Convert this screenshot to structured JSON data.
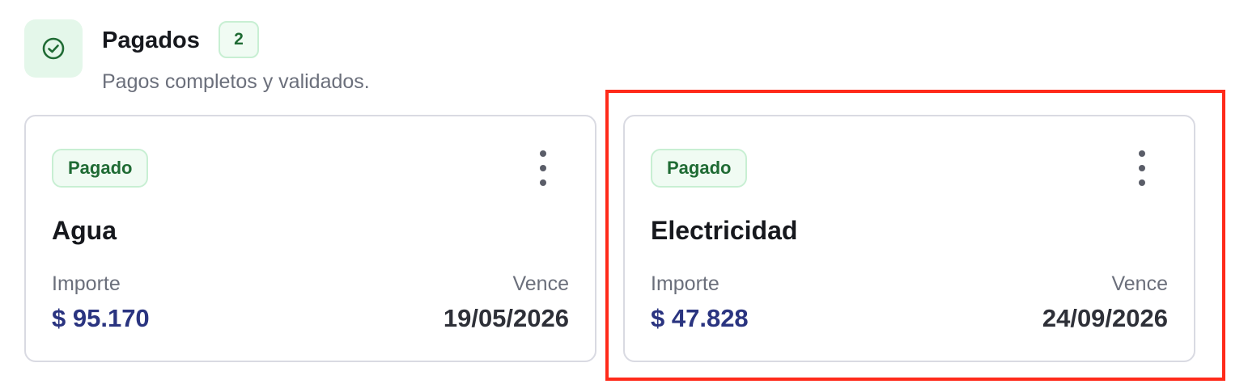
{
  "section": {
    "icon": "check-circle-icon",
    "title": "Pagados",
    "count": "2",
    "subtitle": "Pagos completos y validados."
  },
  "colors": {
    "accent_green": "#1f6b34",
    "icon_bg": "#e4f7ea",
    "amount_blue": "#2a3480",
    "highlight_red": "#ff2a1a"
  },
  "cards": [
    {
      "status": "Pagado",
      "title": "Agua",
      "amount_label": "Importe",
      "amount": "$ 95.170",
      "due_label": "Vence",
      "due_date": "19/05/2026"
    },
    {
      "status": "Pagado",
      "title": "Electricidad",
      "amount_label": "Importe",
      "amount": "$ 47.828",
      "due_label": "Vence",
      "due_date": "24/09/2026"
    }
  ]
}
